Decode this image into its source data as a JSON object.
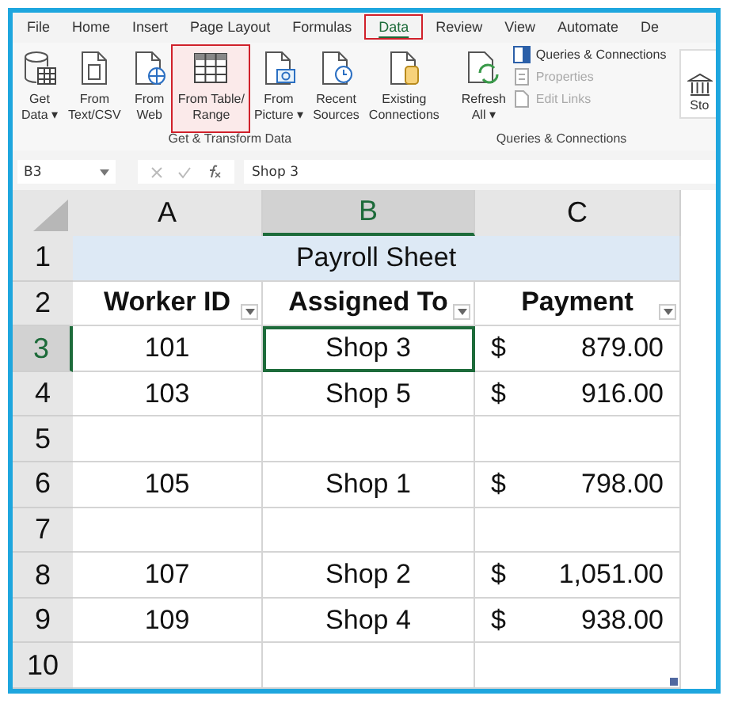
{
  "ribbon_tabs": [
    {
      "label": "File",
      "selected": false,
      "highlighted": false
    },
    {
      "label": "Home",
      "selected": false,
      "highlighted": false
    },
    {
      "label": "Insert",
      "selected": false,
      "highlighted": false
    },
    {
      "label": "Page Layout",
      "selected": false,
      "highlighted": false
    },
    {
      "label": "Formulas",
      "selected": false,
      "highlighted": false
    },
    {
      "label": "Data",
      "selected": true,
      "highlighted": true
    },
    {
      "label": "Review",
      "selected": false,
      "highlighted": false
    },
    {
      "label": "View",
      "selected": false,
      "highlighted": false
    },
    {
      "label": "Automate",
      "selected": false,
      "highlighted": false
    },
    {
      "label": "De",
      "selected": false,
      "highlighted": false
    }
  ],
  "ribbon_groups": [
    {
      "label": "Get & Transform Data",
      "buttons": [
        {
          "kind": "large",
          "lines": [
            "Get",
            "Data ▾"
          ],
          "highlighted": false,
          "disabled": false
        },
        {
          "kind": "large",
          "lines": [
            "From",
            "Text/CSV"
          ],
          "highlighted": false,
          "disabled": false
        },
        {
          "kind": "large",
          "lines": [
            "From",
            "Web"
          ],
          "highlighted": false,
          "disabled": false
        },
        {
          "kind": "large",
          "lines": [
            "From Table/",
            "Range"
          ],
          "highlighted": true,
          "disabled": false
        },
        {
          "kind": "large",
          "lines": [
            "From",
            "Picture ▾"
          ],
          "highlighted": false,
          "disabled": false
        },
        {
          "kind": "large",
          "lines": [
            "Recent",
            "Sources"
          ],
          "highlighted": false,
          "disabled": false
        },
        {
          "kind": "large",
          "lines": [
            "Existing",
            "Connections"
          ],
          "highlighted": false,
          "disabled": false
        }
      ]
    },
    {
      "label": "Queries & Connections",
      "buttons": [
        {
          "kind": "large",
          "lines": [
            "Refresh",
            "All ▾"
          ],
          "highlighted": false,
          "disabled": false
        },
        {
          "kind": "small",
          "lines": [
            "Queries & Connections"
          ],
          "highlighted": false,
          "disabled": false
        },
        {
          "kind": "small",
          "lines": [
            "Properties"
          ],
          "highlighted": false,
          "disabled": true
        },
        {
          "kind": "small",
          "lines": [
            "Edit Links"
          ],
          "highlighted": false,
          "disabled": true
        }
      ]
    }
  ],
  "ribbon_extra": {
    "label": "Sto"
  },
  "formula_bar": {
    "name_box": "B3",
    "formula": "Shop 3"
  },
  "columns": [
    {
      "label": "A",
      "selected": false
    },
    {
      "label": "B",
      "selected": true
    },
    {
      "label": "C",
      "selected": false
    }
  ],
  "rows": [
    {
      "number": "1",
      "kind": "title",
      "selected": false,
      "title": "Payroll Sheet"
    },
    {
      "number": "2",
      "kind": "header",
      "selected": false,
      "headers": [
        "Worker ID",
        "Assigned To",
        "Payment"
      ]
    },
    {
      "number": "3",
      "kind": "data",
      "selected": true,
      "cells": [
        "101",
        "Shop 3"
      ],
      "payment": {
        "currency": "$",
        "amount": "879.00"
      }
    },
    {
      "number": "4",
      "kind": "data",
      "selected": false,
      "cells": [
        "103",
        "Shop 5"
      ],
      "payment": {
        "currency": "$",
        "amount": "916.00"
      }
    },
    {
      "number": "5",
      "kind": "empty",
      "selected": false
    },
    {
      "number": "6",
      "kind": "data",
      "selected": false,
      "cells": [
        "105",
        "Shop 1"
      ],
      "payment": {
        "currency": "$",
        "amount": "798.00"
      }
    },
    {
      "number": "7",
      "kind": "empty",
      "selected": false
    },
    {
      "number": "8",
      "kind": "data",
      "selected": false,
      "cells": [
        "107",
        "Shop 2"
      ],
      "payment": {
        "currency": "$",
        "amount": "1,051.00"
      }
    },
    {
      "number": "9",
      "kind": "data",
      "selected": false,
      "cells": [
        "109",
        "Shop 4"
      ],
      "payment": {
        "currency": "$",
        "amount": "938.00"
      }
    },
    {
      "number": "10",
      "kind": "empty",
      "selected": false
    }
  ]
}
